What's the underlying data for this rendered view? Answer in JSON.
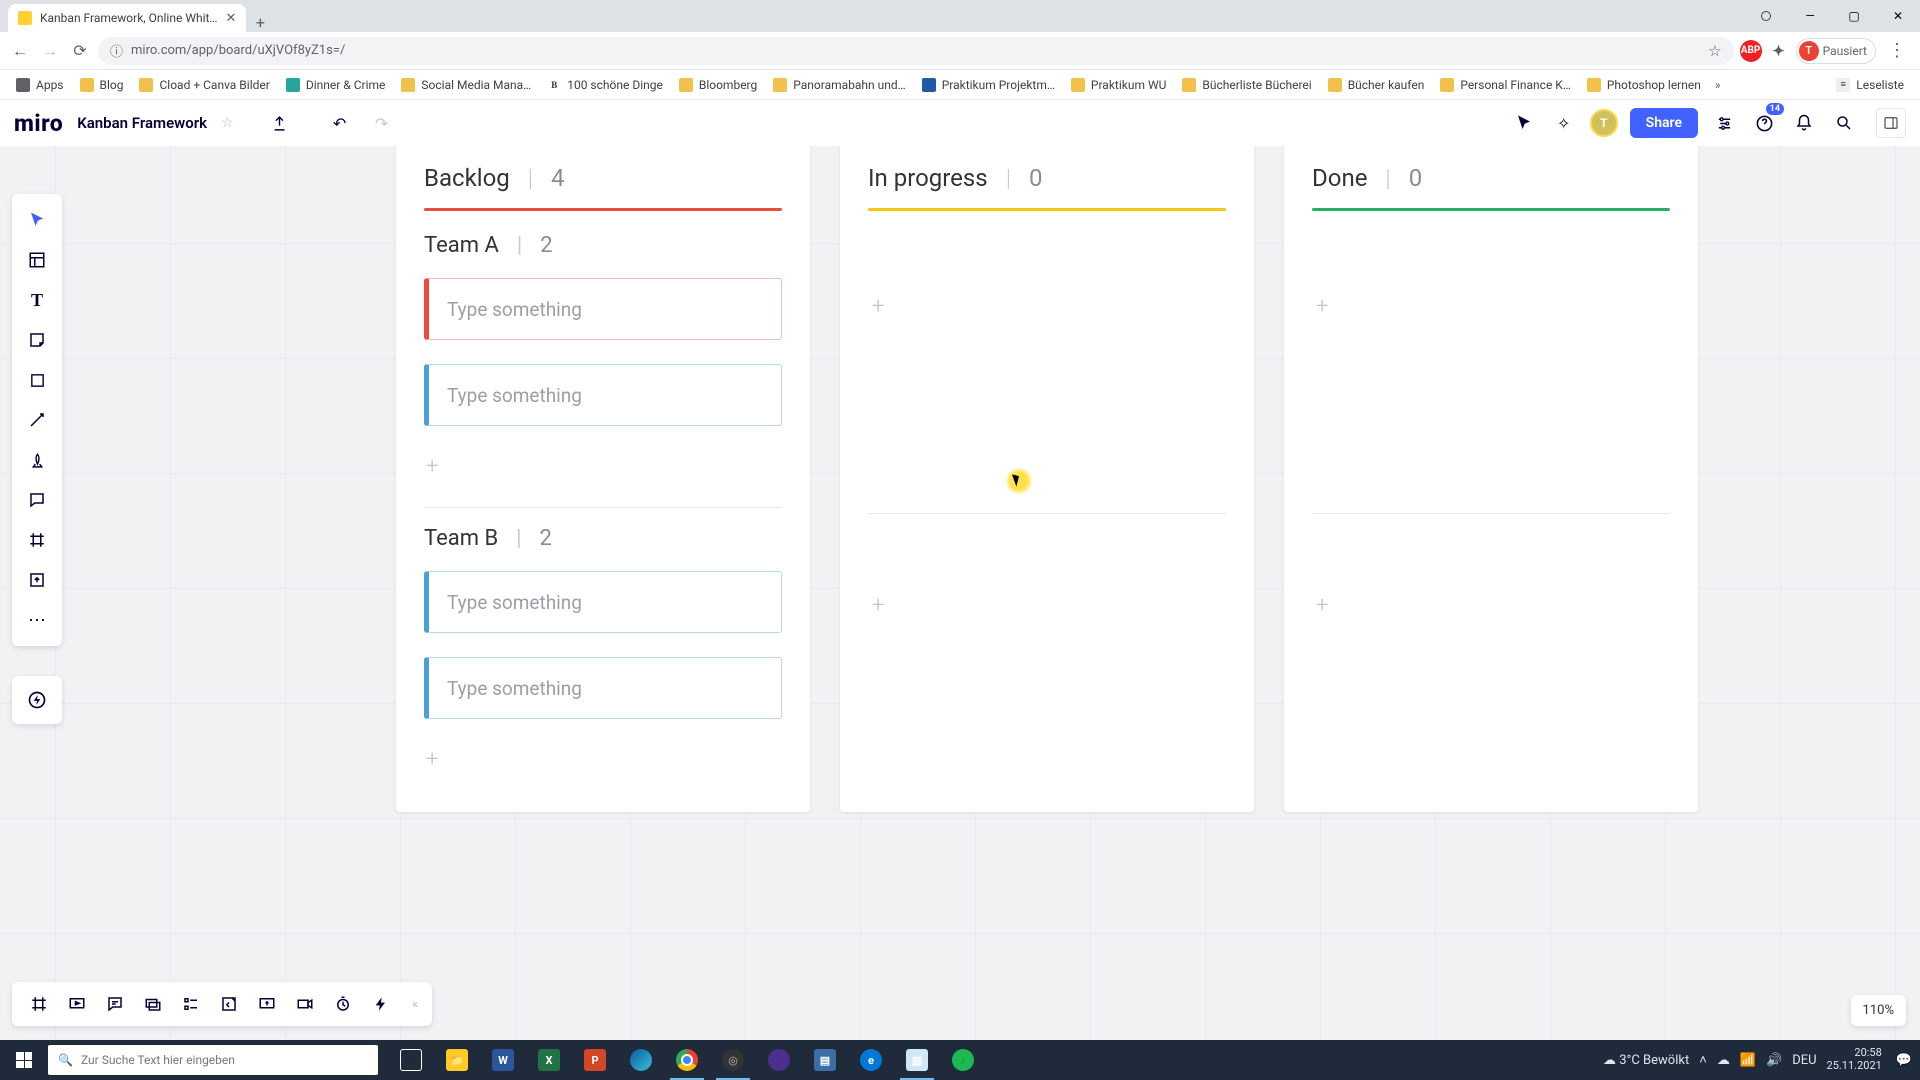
{
  "browser": {
    "tab_title": "Kanban Framework, Online Whit…",
    "url": "miro.com/app/board/uXjVOf8yZ1s=/",
    "profile_status": "Pausiert",
    "profile_initial": "T"
  },
  "bookmarks": [
    {
      "label": "Apps",
      "color": "#5f6368"
    },
    {
      "label": "Blog",
      "color": "#f0c24b"
    },
    {
      "label": "Cload + Canva Bilder",
      "color": "#f0c24b"
    },
    {
      "label": "Dinner & Crime",
      "color": "#26a69a"
    },
    {
      "label": "Social Media Mana…",
      "color": "#f0c24b"
    },
    {
      "label": "100 schöne Dinge",
      "color": "#333",
      "bold": true,
      "prefix": "B"
    },
    {
      "label": "Bloomberg",
      "color": "#f0c24b"
    },
    {
      "label": "Panoramabahn und…",
      "color": "#f0c24b"
    },
    {
      "label": "Praktikum Projektm…",
      "color": "#1e5aa8"
    },
    {
      "label": "Praktikum WU",
      "color": "#f0c24b"
    },
    {
      "label": "Bücherliste Bücherei",
      "color": "#f0c24b"
    },
    {
      "label": "Bücher kaufen",
      "color": "#f0c24b"
    },
    {
      "label": "Personal Finance K…",
      "color": "#f0c24b"
    },
    {
      "label": "Photoshop lernen",
      "color": "#f0c24b"
    }
  ],
  "bookmarks_right": {
    "label": "Leseliste"
  },
  "miro": {
    "logo": "miro",
    "board_title": "Kanban Framework",
    "share": "Share",
    "help_badge": "14",
    "avatar_initial": "T"
  },
  "kanban": {
    "card_placeholder": "Type something",
    "columns": [
      {
        "title": "Backlog",
        "count": "4",
        "line_color": "c-red"
      },
      {
        "title": "In progress",
        "count": "0",
        "line_color": "c-yellow"
      },
      {
        "title": "Done",
        "count": "0",
        "line_color": "c-green"
      }
    ],
    "swimlanes": [
      {
        "title": "Team A",
        "count": "2"
      },
      {
        "title": "Team B",
        "count": "2"
      }
    ]
  },
  "zoom": "110%",
  "taskbar": {
    "search_placeholder": "Zur Suche Text hier eingeben",
    "weather": "3°C  Bewölkt",
    "lang": "DEU",
    "time": "20:58",
    "date": "25.11.2021"
  }
}
